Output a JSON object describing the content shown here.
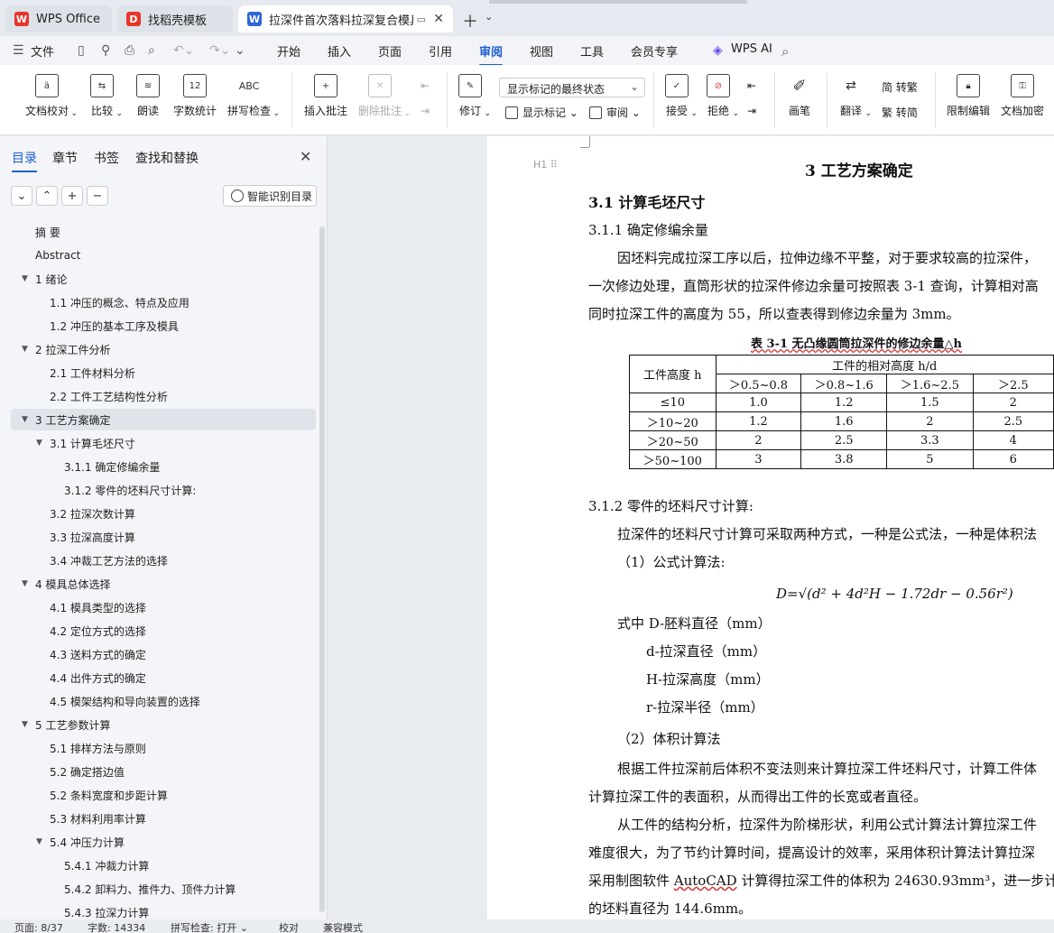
{
  "tabs": [
    {
      "label": "WPS Office",
      "icon": "wps-logo-icon"
    },
    {
      "label": "找稻壳模板",
      "icon": "docer-icon"
    },
    {
      "label": "拉深件首次落料拉深复合模具设计",
      "icon": "writer-icon"
    }
  ],
  "menu": [
    "文件",
    "开始",
    "插入",
    "页面",
    "引用",
    "审阅",
    "视图",
    "工具",
    "会员专享",
    "WPS AI"
  ],
  "menu_active": "审阅",
  "ribbon": {
    "doc_check": "文档校对",
    "compare": "比较",
    "read_aloud": "朗读",
    "word_count": "字数统计",
    "spell_check": "拼写检查",
    "insert_comment": "插入批注",
    "delete_comment": "删除批注",
    "revise": "修订",
    "markup_state": "显示标记的最终状态",
    "show_markup": "显示标记",
    "review": "审阅",
    "accept": "接受",
    "reject": "拒绝",
    "ink": "画笔",
    "translate": "翻译",
    "simp_to_trad": "简 转繁",
    "trad_to_simp": "繁 转简",
    "restrict_edit": "限制编辑",
    "encrypt": "文档加密"
  },
  "panel": {
    "tabs": [
      "目录",
      "章节",
      "书签",
      "查找和替换"
    ],
    "smart_toc": "智能识别目录"
  },
  "toc": [
    {
      "label": "摘  要",
      "level": 0,
      "arrow": false
    },
    {
      "label": "Abstract",
      "level": 0,
      "arrow": false
    },
    {
      "label": "1  绪论",
      "level": 0,
      "arrow": true
    },
    {
      "label": "1.1    冲压的概念、特点及应用",
      "level": 1,
      "arrow": false
    },
    {
      "label": "1.2    冲压的基本工序及模具",
      "level": 1,
      "arrow": false
    },
    {
      "label": "2  拉深工件分析",
      "level": 0,
      "arrow": true
    },
    {
      "label": "2.1  工件材料分析",
      "level": 1,
      "arrow": false
    },
    {
      "label": "2.2  工件工艺结构性分析",
      "level": 1,
      "arrow": false
    },
    {
      "label": "3 工艺方案确定",
      "level": 0,
      "arrow": true,
      "selected": true
    },
    {
      "label": "3.1  计算毛坯尺寸",
      "level": 1,
      "arrow": true
    },
    {
      "label": "3.1.1 确定修编余量",
      "level": 2,
      "arrow": false
    },
    {
      "label": "3.1.2 零件的坯料尺寸计算:",
      "level": 2,
      "arrow": false
    },
    {
      "label": "3.2  拉深次数计算",
      "level": 1,
      "arrow": false
    },
    {
      "label": "3.3 拉深高度计算",
      "level": 1,
      "arrow": false
    },
    {
      "label": "3.4 冲裁工艺方法的选择",
      "level": 1,
      "arrow": false
    },
    {
      "label": "4  模具总体选择",
      "level": 0,
      "arrow": true
    },
    {
      "label": "4.1  模具类型的选择",
      "level": 1,
      "arrow": false
    },
    {
      "label": "4.2  定位方式的选择",
      "level": 1,
      "arrow": false
    },
    {
      "label": "4.3  送料方式的确定",
      "level": 1,
      "arrow": false
    },
    {
      "label": "4.4  出件方式的确定",
      "level": 1,
      "arrow": false
    },
    {
      "label": "4.5 模架结构和导向装置的选择",
      "level": 1,
      "arrow": false
    },
    {
      "label": "5  工艺参数计算",
      "level": 0,
      "arrow": true
    },
    {
      "label": "5.1 排样方法与原则",
      "level": 1,
      "arrow": false
    },
    {
      "label": "5.2  确定搭边值",
      "level": 1,
      "arrow": false
    },
    {
      "label": "5.2  条料宽度和步距计算",
      "level": 1,
      "arrow": false
    },
    {
      "label": "5.3  材料利用率计算",
      "level": 1,
      "arrow": false
    },
    {
      "label": "5.4  冲压力计算",
      "level": 1,
      "arrow": true
    },
    {
      "label": "5.4.1 冲裁力计算",
      "level": 2,
      "arrow": false
    },
    {
      "label": "5.4.2 卸料力、推件力、顶件力计算",
      "level": 2,
      "arrow": false
    },
    {
      "label": "5.4.3 拉深力计算",
      "level": 2,
      "arrow": false
    }
  ],
  "doc": {
    "chapter_title": "3 工艺方案确定",
    "sec_31": "3.1  计算毛坯尺寸",
    "sec_311": "3.1.1 确定修编余量",
    "p1": "因坯料完成拉深工序以后，拉伸边缘不平整，对于要求较高的拉深件，",
    "p2": "一次修边处理，直筒形状的拉深件修边余量可按照表 3-1 查询，计算相对高",
    "p3": "同时拉深工件的高度为 55，所以查表得到修边余量为 3mm。",
    "table_caption": "表 3-1  无凸缘圆筒拉深件的修边余量△h",
    "table_head1": "工件高度 h",
    "table_head2": "工件的相对高度 h/d",
    "table_cols": [
      "＞0.5~0.8",
      "＞0.8~1.6",
      "＞1.6~2.5",
      "＞2.5"
    ],
    "table_rows": [
      [
        "≤10",
        "1.0",
        "1.2",
        "1.5",
        "2"
      ],
      [
        "＞10~20",
        "1.2",
        "1.6",
        "2",
        "2.5"
      ],
      [
        "＞20~50",
        "2",
        "2.5",
        "3.3",
        "4"
      ],
      [
        "＞50~100",
        "3",
        "3.8",
        "5",
        "6"
      ]
    ],
    "sec_312": "3.1.2 零件的坯料尺寸计算:",
    "p4": "拉深件的坯料尺寸计算可采取两种方式，一种是公式法，一种是体积法",
    "p5": "（1）公式计算法:",
    "formula": "D=√(d² + 4d²H − 1.72dr − 0.56r²)",
    "p6": "式中 D-胚料直径（mm）",
    "p7": "d-拉深直径（mm）",
    "p8": "H-拉深高度（mm）",
    "p9": "r-拉深半径（mm）",
    "p10": "（2）体积计算法",
    "p11": "根据工件拉深前后体积不变法则来计算拉深工件坯料尺寸，计算工件体",
    "p12": "计算拉深工件的表面积，从而得出工件的长宽或者直径。",
    "p13": "从工件的结构分析，拉深件为阶梯形状，利用公式计算法计算拉深工件",
    "p14": "难度很大，为了节约计算时间，提高设计的效率，采用体积计算法计算拉深",
    "p15a": "采用制图软件 ",
    "p15b": "AutoCAD",
    "p15c": " 计算得拉深工件的体积为 24630.93mm³，进一步计",
    "p16": "的坯料直径为 144.6mm。"
  },
  "status": {
    "page": "页面: 8/37",
    "words": "字数: 14334",
    "spell": "拼写检查: 打开",
    "proof": "校对",
    "compat": "兼容模式"
  },
  "colors": {
    "accent": "#1a5fd0",
    "wps_red": "#e8352a",
    "writer_blue": "#2f66d8"
  }
}
